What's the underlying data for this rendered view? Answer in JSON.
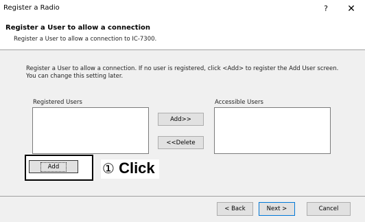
{
  "window": {
    "title": "Register a Radio",
    "help_label": "?",
    "close_label": "✕"
  },
  "header": {
    "title": "Register a User to allow a connection",
    "subtitle": "Register a User to allow a connection to IC-7300."
  },
  "main": {
    "description": "Register a User to allow a connection. If no user is registered, click <Add> to register the Add User screen. You can change this setting later.",
    "registered_users_label": "Registered Users",
    "accessible_users_label": "Accessible Users",
    "registered_users": [],
    "accessible_users": [],
    "add_right_label": "Add>>",
    "delete_label": "<<Delete",
    "add_user_label": "Add"
  },
  "annotation": {
    "step_number": "①",
    "text": "Click"
  },
  "footer": {
    "back_label": "< Back",
    "next_label": "Next >",
    "cancel_label": "Cancel"
  }
}
